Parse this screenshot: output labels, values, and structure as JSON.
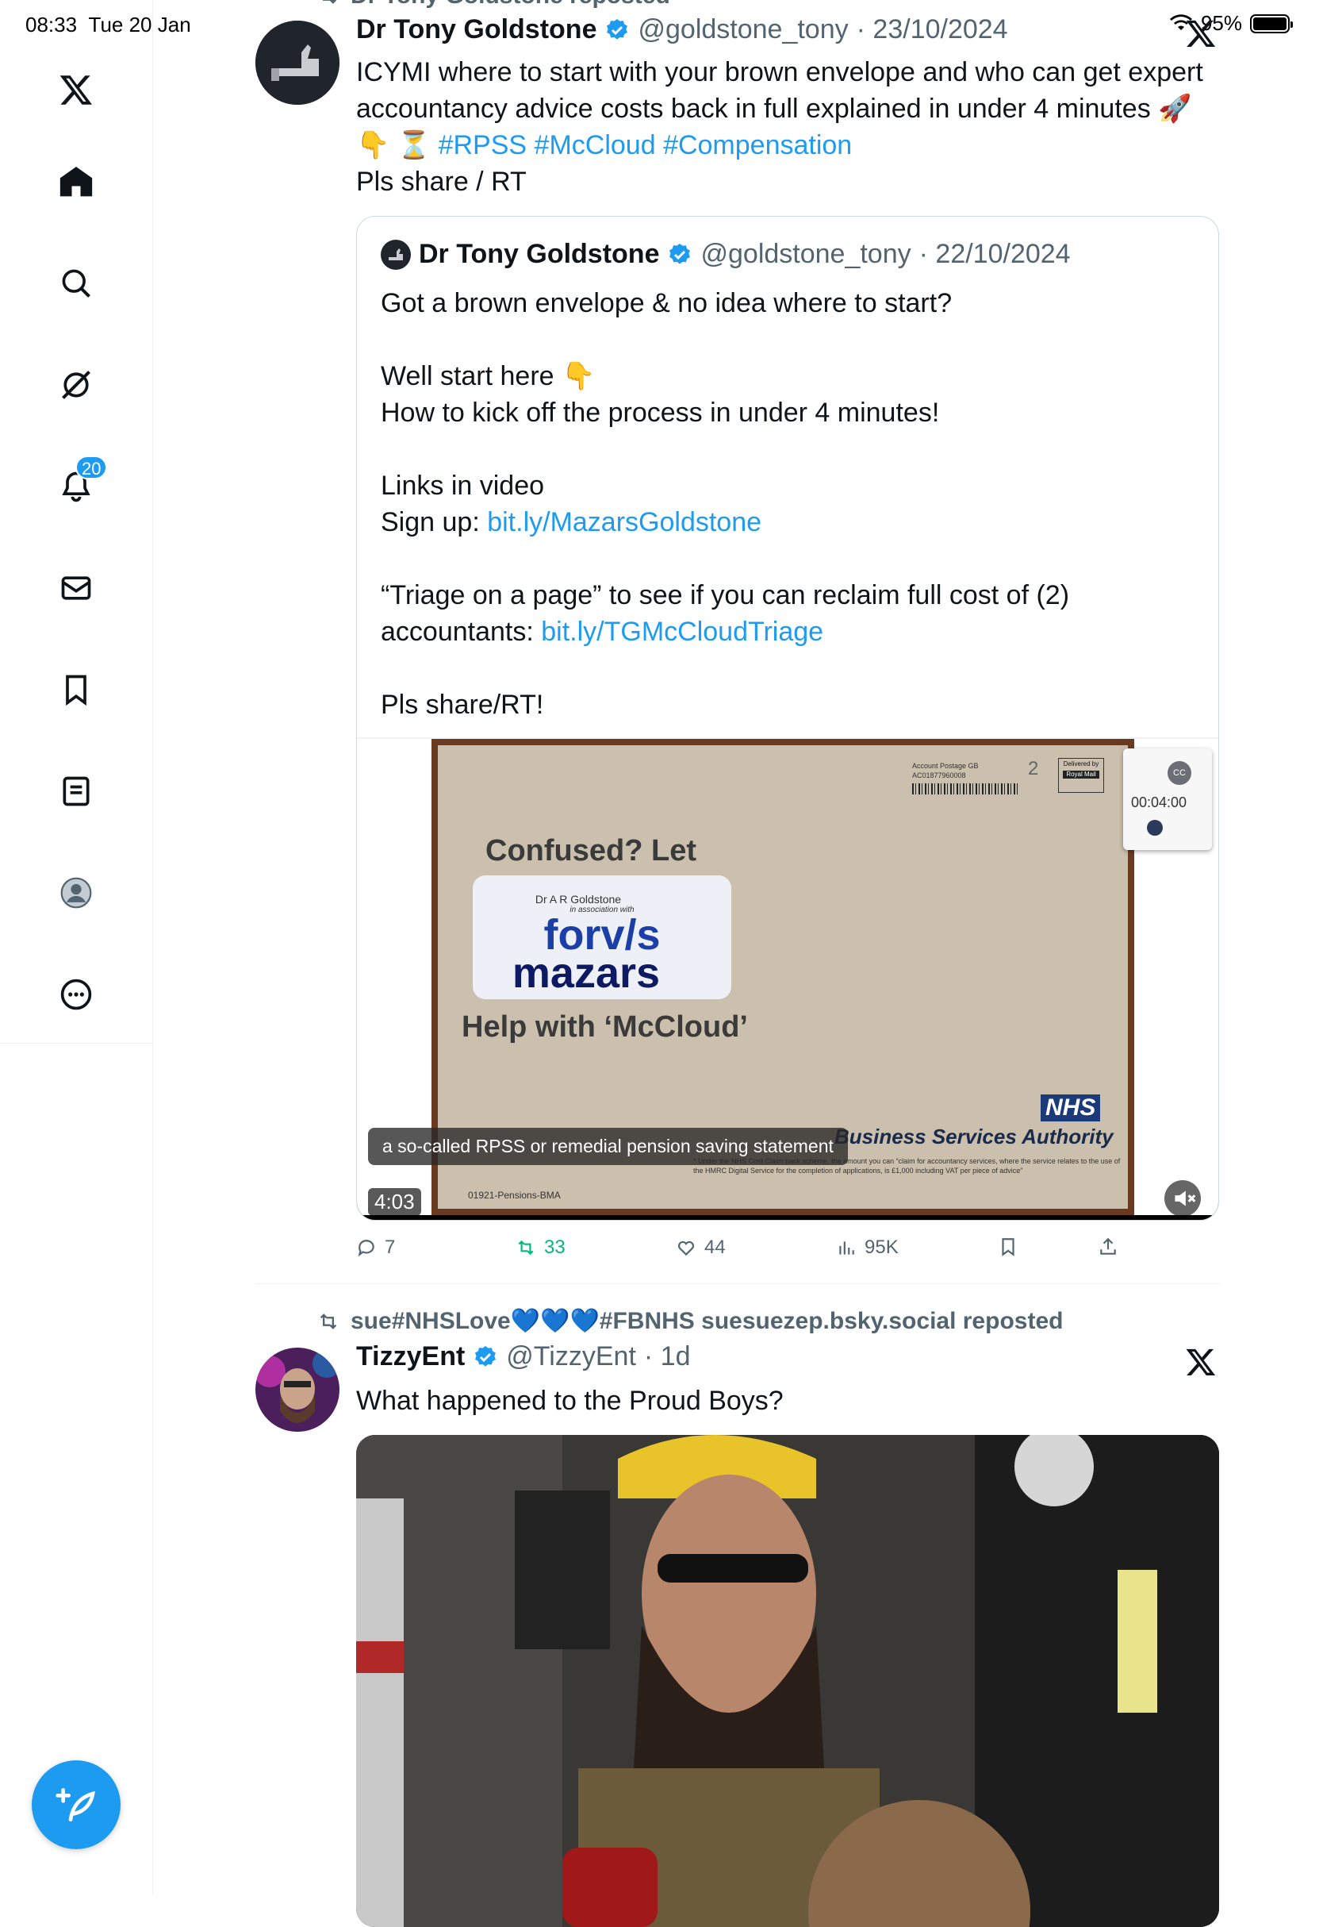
{
  "status_bar": {
    "time": "08:33",
    "date": "Tue 20 Jan",
    "battery": "95%"
  },
  "sidebar": {
    "notification_badge": "20",
    "items": [
      {
        "name": "x-logo-icon"
      },
      {
        "name": "home-icon"
      },
      {
        "name": "search-icon"
      },
      {
        "name": "grok-icon"
      },
      {
        "name": "notifications-icon"
      },
      {
        "name": "messages-icon"
      },
      {
        "name": "bookmarks-icon"
      },
      {
        "name": "lists-icon"
      },
      {
        "name": "profile-icon"
      },
      {
        "name": "more-icon"
      }
    ],
    "compose_icon": "feather-plus-icon"
  },
  "tweet1": {
    "repost_label": "Dr Tony Goldstone reposted",
    "name": "Dr Tony Goldstone",
    "handle": "@goldstone_tony",
    "date": "· 23/10/2024",
    "text_line1": "ICYMI where to start with your brown envelope and who can get expert",
    "text_line2": "accountancy advice costs back in full explained in under 4 minutes 🚀",
    "text_line3_prefix": "👇 ⏳",
    "hashtags": [
      "#RPSS",
      "#McCloud",
      "#Compensation"
    ],
    "text_line4": "Pls share / RT",
    "quote": {
      "name": "Dr Tony Goldstone",
      "handle": "@goldstone_tony",
      "date": "· 22/10/2024",
      "line1": "Got a brown envelope & no idea where to start?",
      "line2": "Well start here 👇",
      "line3": "How to kick off the process in under 4 minutes!",
      "line4": "Links in video",
      "line5_prefix": "Sign up: ",
      "link1": "bit.ly/MazarsGoldstone",
      "line6": "“Triage on a page” to see if you can reclaim full cost of (2)",
      "line7_prefix": "accountants: ",
      "link2": "bit.ly/TGMcCloudTriage",
      "line8": "Pls share/RT!",
      "video": {
        "caption": "a so-called RPSS or remedial pension saving statement",
        "duration": "4:03",
        "pip_time": "00:04:00",
        "envelope_top_text": "Confused? Let",
        "envelope_name": "Dr A R Goldstone",
        "envelope_assoc": "in association with",
        "brand1": "forv/s",
        "brand2": "mazars",
        "envelope_bottom_text": "Help with ‘McCloud’",
        "nhs": "NHS",
        "authority": "Business Services Authority",
        "ref": "01921-Pensions-BMA",
        "postage": "Account Postage GB",
        "account_no": "AC01877960008",
        "delivered_by": "Delivered by",
        "royal_mail": "Royal Mail",
        "class": "2",
        "fine_print": "* Under the NHS Cost Claim back scheme, the amount you can “claim for accountancy services, where the service relates to the use of the HMRC Digital Service for the completion of applications, is £1,000 including VAT per piece of advice”"
      }
    },
    "stats": {
      "replies": "7",
      "reposts": "33",
      "likes": "44",
      "views": "95K"
    }
  },
  "tweet2": {
    "repost_label": "sue#NHSLove💙💙💙#FBNHS suesuezep.bsky.social reposted",
    "name": "TizzyEnt",
    "handle": "@TizzyEnt",
    "date": "· 1d",
    "text": "What happened to the Proud Boys?"
  },
  "colors": {
    "accent": "#1d9bf0",
    "repost_green": "#00ba7c",
    "secondary_text": "#536471"
  }
}
